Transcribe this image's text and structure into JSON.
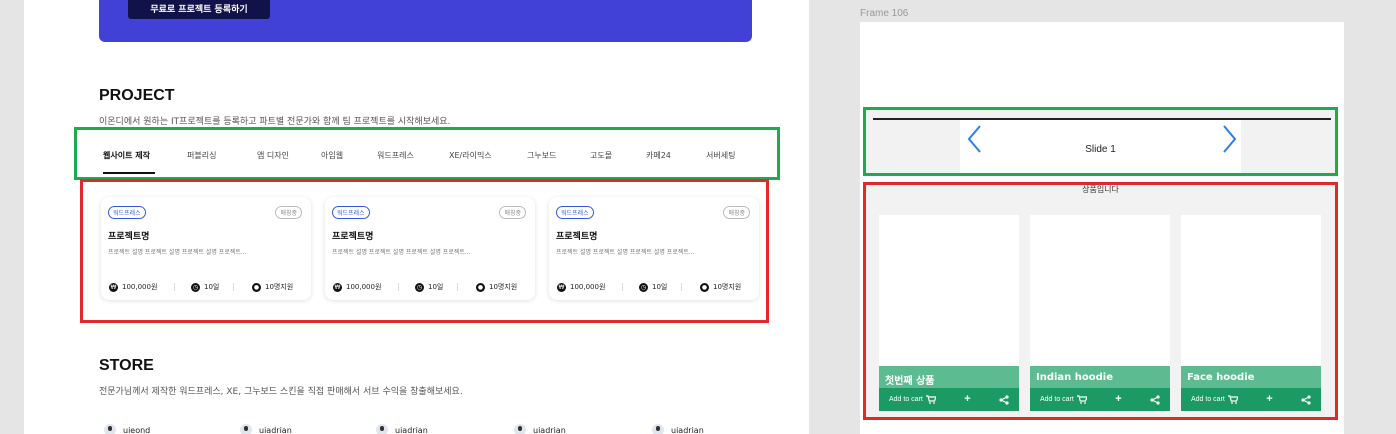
{
  "banner": {
    "button_label": "무료로 프로젝트 등록하기"
  },
  "project": {
    "title": "PROJECT",
    "subtitle": "이온디에서 원하는 IT프로젝트를 등록하고 파트별 전문가와 함께 팀 프로젝트를 시작해보세요.",
    "tabs": [
      {
        "label": "웹사이트 제작",
        "active": true
      },
      {
        "label": "퍼블리싱"
      },
      {
        "label": "앱 디자인"
      },
      {
        "label": "아임웹"
      },
      {
        "label": "워드프레스"
      },
      {
        "label": "XE/라이믹스"
      },
      {
        "label": "그누보드"
      },
      {
        "label": "고도몰"
      },
      {
        "label": "카페24"
      },
      {
        "label": "서버세팅"
      }
    ],
    "cards": [
      {
        "badge": "워드프레스",
        "status": "매칭중",
        "title": "프로젝트명",
        "desc": "프로젝트 설명 프로젝트 설명 프로젝트 설명 프로젝트...",
        "price": "100,000원",
        "days": "10일",
        "applicants": "10명지원"
      },
      {
        "badge": "워드프레스",
        "status": "매칭중",
        "title": "프로젝트명",
        "desc": "프로젝트 설명 프로젝트 설명 프로젝트 설명 프로젝트...",
        "price": "100,000원",
        "days": "10일",
        "applicants": "10명지원"
      },
      {
        "badge": "워드프레스",
        "status": "매칭중",
        "title": "프로젝트명",
        "desc": "프로젝트 설명 프로젝트 설명 프로젝트 설명 프로젝트...",
        "price": "100,000원",
        "days": "10일",
        "applicants": "10명지원"
      }
    ]
  },
  "store": {
    "title": "STORE",
    "subtitle": "전문가님께서 제작한 워드프레스, XE, 그누보드 스킨을 직접 판매해서 서브 수익을 창출해보세요.",
    "sellers": [
      "uieond",
      "uiadrian",
      "uiadrian",
      "uiadrian",
      "uiadrian"
    ]
  },
  "frame": {
    "label": "Frame 106",
    "slide_label": "Slide 1",
    "products_heading": "상품입니다",
    "products": [
      {
        "name": "첫번째 상품",
        "cart_label": "Add to cart"
      },
      {
        "name": "Indian hoodie",
        "cart_label": "Add to cart"
      },
      {
        "name": "Face hoodie",
        "cart_label": "Add to cart"
      }
    ]
  },
  "colors": {
    "banner": "#4141d8",
    "highlight_green": "#1faa4f",
    "highlight_red": "#e02a2a",
    "product_name_bg": "#5dbb92",
    "product_actions_bg": "#1b9a64",
    "arrow": "#2f7fe0"
  }
}
